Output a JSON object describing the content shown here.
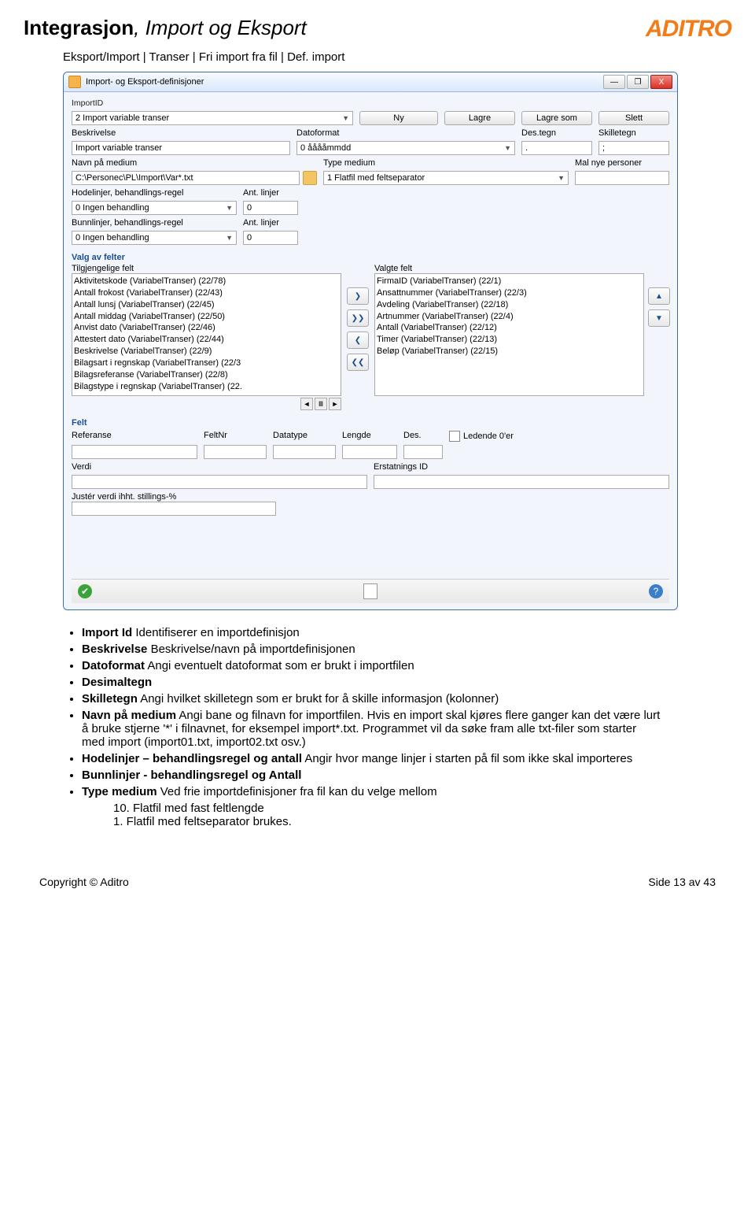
{
  "header": {
    "title_part1_bold": "Integrasjon",
    "title_rest": ", Import og Eksport",
    "logo": "ADITRO"
  },
  "breadcrumb": "Eksport/Import | Transer | Fri import fra fil | Def. import",
  "win": {
    "title": "Import- og Eksport-definisjoner",
    "btn_min": "—",
    "btn_max": "❐",
    "btn_close": "X",
    "labels": {
      "importid": "ImportID",
      "beskrivelse": "Beskrivelse",
      "datoformat": "Datoformat",
      "destegn": "Des.tegn",
      "skilletegn": "Skilletegn",
      "navn_medium": "Navn på medium",
      "type_medium": "Type medium",
      "mal_nye": "Mal nye personer",
      "hodelinjer": "Hodelinjer, behandlings-regel",
      "ant_linjer": "Ant. linjer",
      "bunnlinjer": "Bunnlinjer, behandlings-regel",
      "valg_av_felter": "Valg av felter",
      "tilgjengelige": "Tilgjengelige felt",
      "valgte": "Valgte felt",
      "felt": "Felt",
      "referanse": "Referanse",
      "feltnr": "FeltNr",
      "datatype": "Datatype",
      "lengde": "Lengde",
      "des": "Des.",
      "ledende": "Ledende 0'er",
      "verdi": "Verdi",
      "erstatnings": "Erstatnings ID",
      "juster": "Justér verdi ihht. stillings-%"
    },
    "buttons": {
      "ny": "Ny",
      "lagre": "Lagre",
      "lagresom": "Lagre som",
      "slett": "Slett"
    },
    "values": {
      "importid": "2 Import variable transer",
      "beskrivelse": "Import variable transer",
      "datoformat": "0 ååååmmdd",
      "destegn": ".",
      "skilletegn": ";",
      "navn_medium": "C:\\Personec\\PL\\Import\\Var*.txt",
      "type_medium": "1 Flatfil med feltseparator",
      "mal_nye": "",
      "hodelinjer": "0 Ingen behandling",
      "hode_ant": "0",
      "bunnlinjer": "0 Ingen behandling",
      "bunn_ant": "0"
    },
    "avail": [
      "Aktivitetskode (VariabelTranser) (22/78)",
      "Antall frokost (VariabelTranser) (22/43)",
      "Antall lunsj (VariabelTranser) (22/45)",
      "Antall middag (VariabelTranser) (22/50)",
      "Anvist dato (VariabelTranser) (22/46)",
      "Attestert dato (VariabelTranser) (22/44)",
      "Beskrivelse (VariabelTranser) (22/9)",
      "Bilagsart i regnskap (VariabelTranser) (22/3",
      "Bilagsreferanse (VariabelTranser) (22/8)",
      "Bilagstype i regnskap (VariabelTranser) (22."
    ],
    "selected": [
      "FirmaID (VariabelTranser) (22/1)",
      "Ansattnummer (VariabelTranser) (22/3)",
      "Avdeling (VariabelTranser) (22/18)",
      "Artnummer (VariabelTranser) (22/4)",
      "Antall (VariabelTranser) (22/12)",
      "Timer (VariabelTranser) (22/13)",
      "Beløp (VariabelTranser) (22/15)"
    ],
    "mid_btns": [
      "❯",
      "❯❯",
      "❮",
      "❮❮"
    ],
    "side_btns": [
      "▲",
      "▼"
    ]
  },
  "bullets": [
    {
      "b": "Import Id",
      "t": " Identifiserer en importdefinisjon"
    },
    {
      "b": "Beskrivelse",
      "t": " Beskrivelse/navn på importdefinisjonen"
    },
    {
      "b": "Datoformat",
      "t": " Angi eventuelt datoformat som er brukt i importfilen"
    },
    {
      "b": "Desimaltegn",
      "t": ""
    },
    {
      "b": "Skilletegn",
      "t": " Angi hvilket skilletegn som er brukt for å skille informasjon (kolonner)"
    },
    {
      "b": "Navn på medium",
      "t": " Angi bane og filnavn for importfilen. Hvis en import skal kjøres flere ganger kan det være lurt å bruke stjerne '*' i filnavnet, for eksempel import*.txt. Programmet vil da søke fram alle txt-filer som starter med import (import01.txt, import02.txt osv.)"
    },
    {
      "b": "Hodelinjer – behandlingsregel og antall",
      "t": " Angir hvor mange linjer i starten på fil som ikke skal importeres"
    },
    {
      "b": "Bunnlinjer - behandlingsregel og Antall",
      "t": ""
    },
    {
      "b": "Type medium",
      "t": " Ved frie importdefinisjoner fra fil kan du velge mellom"
    }
  ],
  "sublist": [
    "Flatfil med fast feltlengde",
    "Flatfil med feltseparator brukes."
  ],
  "sub_numbers": [
    "10.",
    "1."
  ],
  "footer": {
    "left": "Copyright © Aditro",
    "right": "Side 13 av 43"
  }
}
